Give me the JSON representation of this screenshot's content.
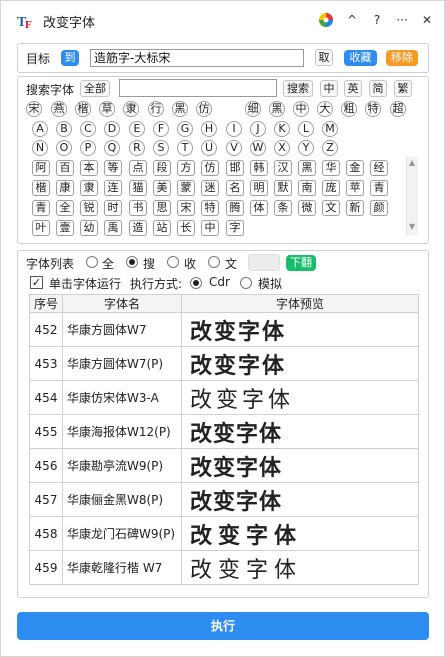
{
  "window": {
    "title": "改变字体",
    "pin_icon": "color-wheel-icon",
    "collapse_glyph": "^",
    "help_glyph": "?",
    "more_glyph": "···",
    "close_glyph": "✕"
  },
  "target": {
    "label": "目标",
    "to_label": "到",
    "value": "造筋字-大标宋",
    "cancel_label": "取",
    "favorite_label": "收藏",
    "remove_label": "移除"
  },
  "search": {
    "label": "搜索字体",
    "all_label": "全部",
    "input_value": "",
    "search_label": "搜索",
    "lang_buttons": [
      "中",
      "英",
      "简",
      "繁"
    ],
    "chips_row1": [
      "宋",
      "燕",
      "楷",
      "草",
      "隶",
      "行",
      "黑",
      "仿",
      "细",
      "黑",
      "中",
      "大",
      "粗",
      "特",
      "超"
    ],
    "letters_row1": [
      "A",
      "B",
      "C",
      "D",
      "E",
      "F",
      "G",
      "H",
      "I",
      "J",
      "K",
      "L",
      "M"
    ],
    "letters_row2": [
      "N",
      "O",
      "P",
      "Q",
      "R",
      "S",
      "T",
      "U",
      "V",
      "W",
      "X",
      "Y",
      "Z"
    ],
    "chips_row4": [
      "阿",
      "百",
      "本",
      "等",
      "点",
      "段",
      "方",
      "仿",
      "邯",
      "韩",
      "汉",
      "黑",
      "华",
      "金",
      "经"
    ],
    "chips_row5": [
      "楷",
      "康",
      "隶",
      "连",
      "猫",
      "美",
      "蒙",
      "迷",
      "名",
      "明",
      "默",
      "南",
      "庞",
      "苹",
      "青"
    ],
    "chips_row6": [
      "青",
      "全",
      "锐",
      "时",
      "书",
      "思",
      "宋",
      "特",
      "腾",
      "体",
      "条",
      "微",
      "文",
      "新",
      "颜"
    ],
    "chips_row7": [
      "叶",
      "壹",
      "幼",
      "禹",
      "造",
      "站",
      "长",
      "中",
      "字"
    ]
  },
  "list": {
    "label": "字体列表",
    "radio_all": "全",
    "radio_search": "搜",
    "radio_fav": "收",
    "radio_text": "文",
    "page_next": "下翻",
    "single_run_label": "单击字体运行",
    "exec_mode_label": "执行方式:",
    "mode_cdr": "Cdr",
    "mode_sim": "模拟",
    "headers": [
      "序号",
      "字体名",
      "字体预览"
    ],
    "preview_text": "改变字体",
    "rows": [
      {
        "idx": "452",
        "name": "华康方圆体W7"
      },
      {
        "idx": "453",
        "name": "华康方圆体W7(P)"
      },
      {
        "idx": "454",
        "name": "华康仿宋体W3-A"
      },
      {
        "idx": "455",
        "name": "华康海报体W12(P)"
      },
      {
        "idx": "456",
        "name": "华康勘亭流W9(P)"
      },
      {
        "idx": "457",
        "name": "华康俪金黑W8(P)"
      },
      {
        "idx": "458",
        "name": "华康龙门石碑W9(P)"
      },
      {
        "idx": "459",
        "name": "华康乾隆行楷 W7"
      }
    ]
  },
  "execute_label": "执行",
  "colors": {
    "blue": "#2d8cf0",
    "orange": "#f59a23",
    "green": "#19be6b"
  }
}
